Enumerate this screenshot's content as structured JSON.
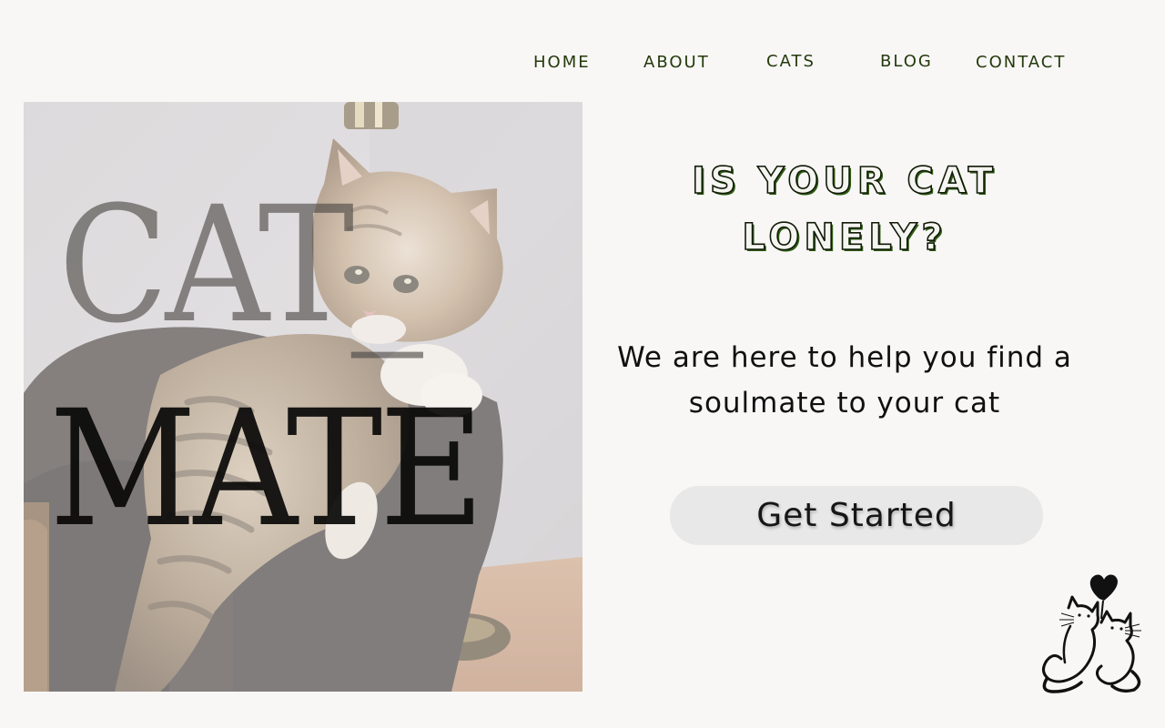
{
  "nav": {
    "items": [
      {
        "label": "HOME"
      },
      {
        "label": "ABOUT"
      },
      {
        "label": "CATS"
      },
      {
        "label": "BLOG"
      },
      {
        "label": "CONTACT"
      }
    ]
  },
  "hero": {
    "wordmark_line1": "CAT_",
    "wordmark_line2": "MATE",
    "photo_subject": "kitten-on-armchair"
  },
  "main": {
    "headline_line1": "IS YOUR CAT",
    "headline_line2": "LONELY?",
    "tagline_line1": "We are here to help you find a",
    "tagline_line2": "soulmate to your cat",
    "cta_label": "Get Started"
  },
  "logo": {
    "icon": "two-cats-heart-logo"
  },
  "colors": {
    "background": "#f8f7f6",
    "nav_text": "#243a0c",
    "headline_shadow": "#2f5d14",
    "cta_background": "#e8e8e8"
  }
}
